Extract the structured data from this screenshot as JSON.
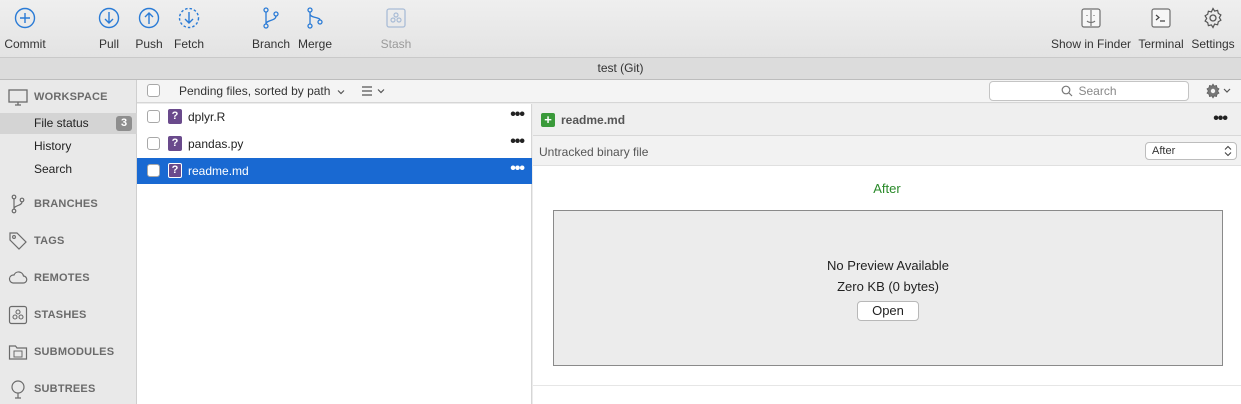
{
  "toolbar": {
    "commit": "Commit",
    "pull": "Pull",
    "push": "Push",
    "fetch": "Fetch",
    "branch": "Branch",
    "merge": "Merge",
    "stash": "Stash",
    "show_in_finder": "Show in Finder",
    "terminal": "Terminal",
    "settings": "Settings"
  },
  "window_title": "test (Git)",
  "sidebar": {
    "workspace": "WORKSPACE",
    "items": [
      {
        "label": "File status",
        "badge": "3"
      },
      {
        "label": "History"
      },
      {
        "label": "Search"
      }
    ],
    "branches": "BRANCHES",
    "tags": "TAGS",
    "remotes": "REMOTES",
    "stashes": "STASHES",
    "submodules": "SUBMODULES",
    "subtrees": "SUBTREES"
  },
  "filepane": {
    "sort_label": "Pending files, sorted by path",
    "search_placeholder": "Search",
    "files": [
      {
        "name": "dplyr.R",
        "status_icon": "?"
      },
      {
        "name": "pandas.py",
        "status_icon": "?"
      },
      {
        "name": "readme.md",
        "status_icon": "?"
      }
    ]
  },
  "diff": {
    "file_name": "readme.md",
    "status_icon": "+",
    "subtitle": "Untracked binary file",
    "view_select": "After",
    "after_heading": "After",
    "preview_message": "No Preview Available",
    "size_text": "Zero KB (0 bytes)",
    "open_label": "Open"
  },
  "colors": {
    "selection": "#1969d2",
    "untracked_badge": "#6a4a8c",
    "added_badge": "#3a9a3a",
    "after_heading": "#2a8a2a"
  }
}
